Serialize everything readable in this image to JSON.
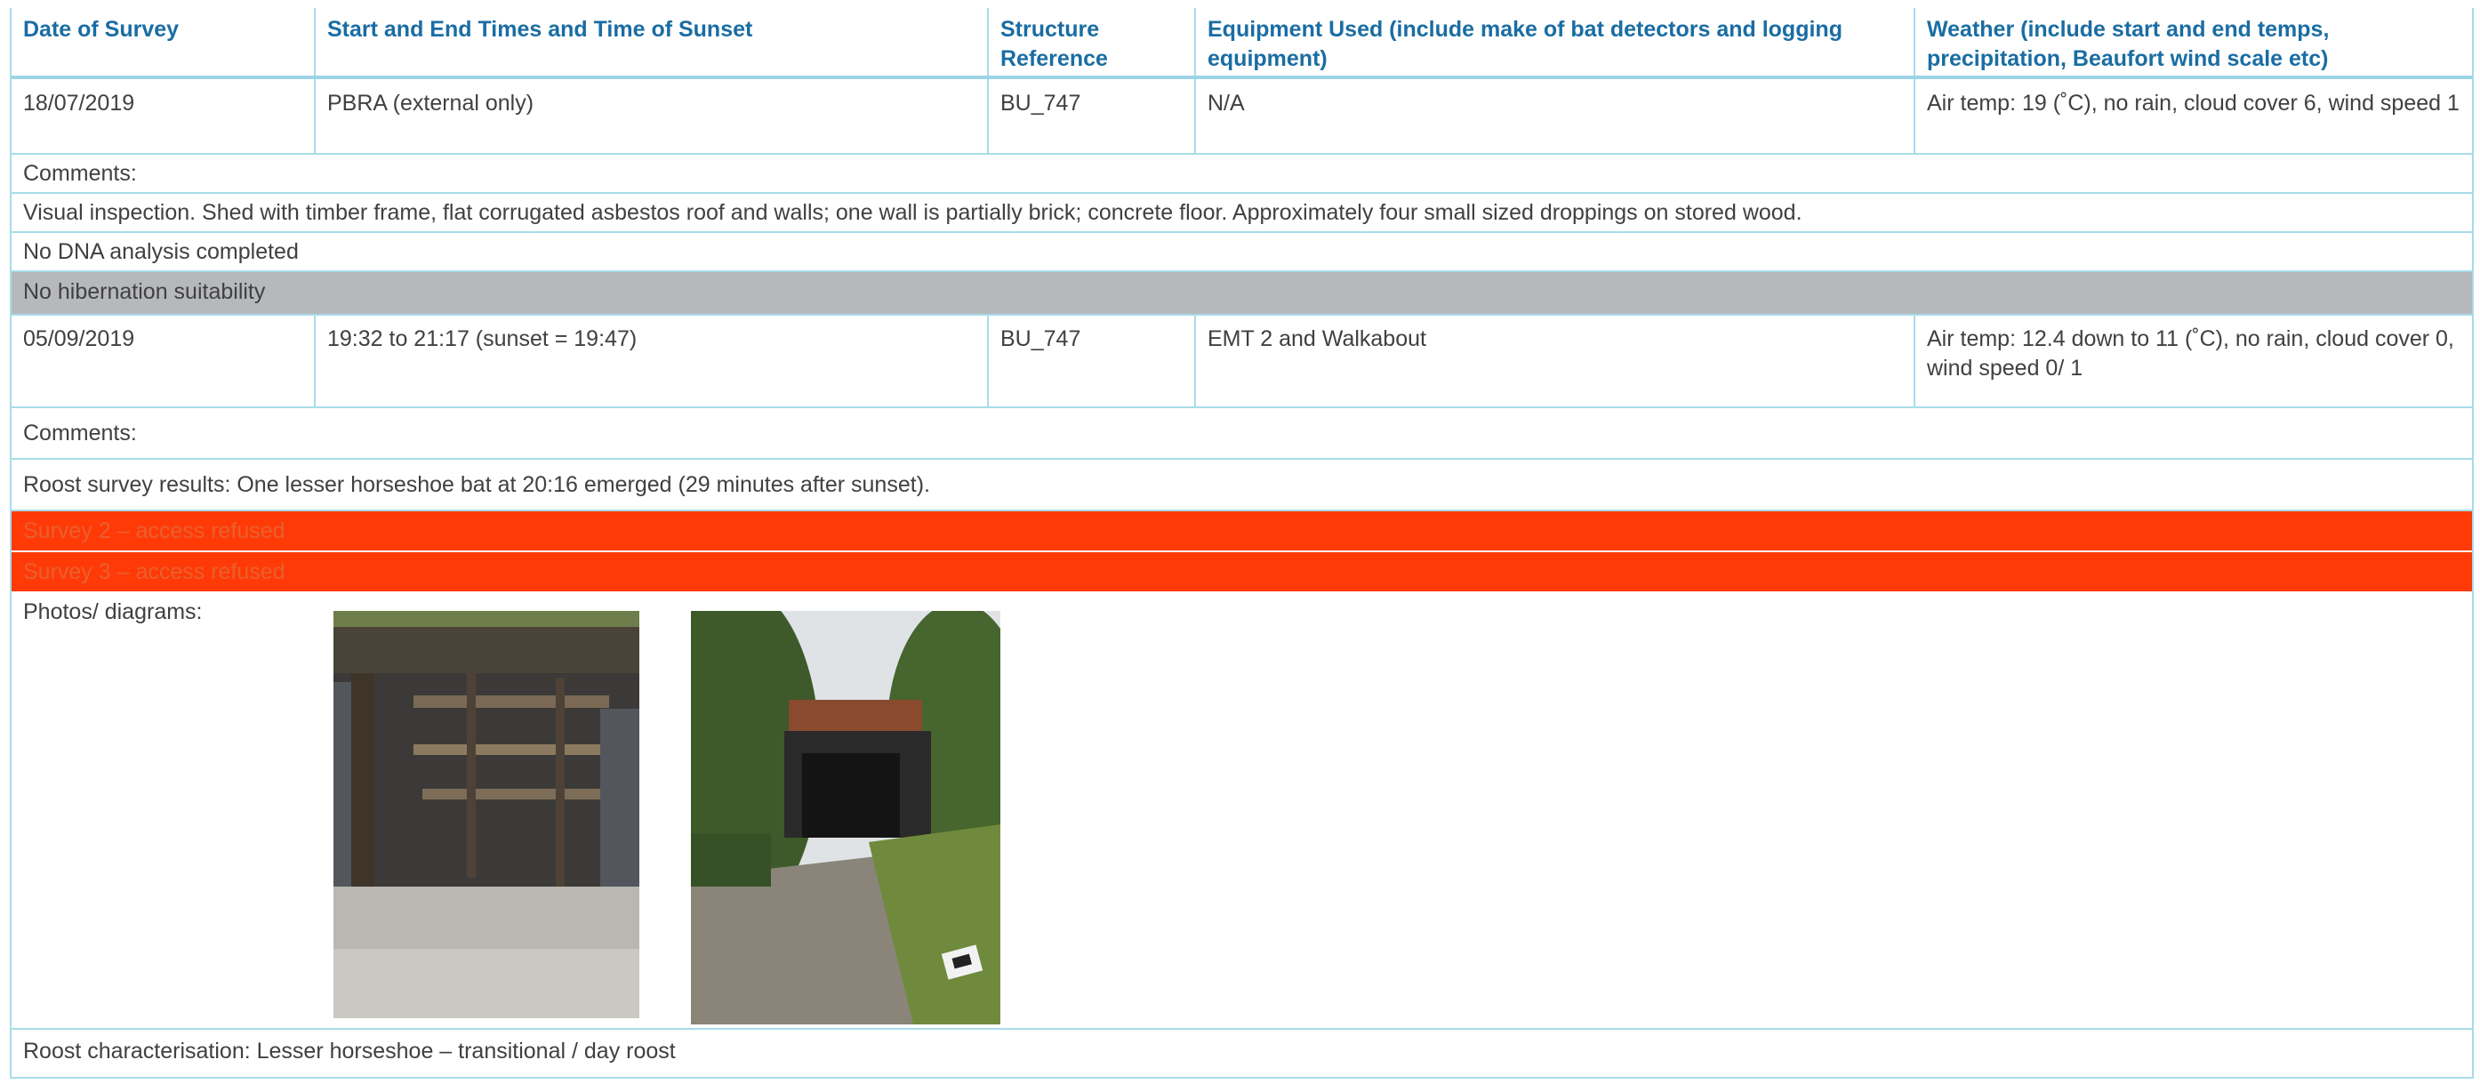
{
  "header": {
    "date": "Date of Survey",
    "times": "Start and End Times and Time of Sunset",
    "structure": "Structure Reference",
    "equipment": "Equipment Used (include make of bat detectors and logging equipment)",
    "weather": "Weather (include start and end temps, precipitation, Beaufort wind scale etc)"
  },
  "survey1": {
    "date": "18/07/2019",
    "times": "PBRA (external only)",
    "structure": "BU_747",
    "equipment": "N/A",
    "weather": "Air temp: 19 (˚C), no rain, cloud cover 6, wind speed 1",
    "comments_label": "Comments:",
    "comments": "Visual inspection. Shed with timber frame, flat corrugated asbestos roof and walls; one wall is partially brick; concrete floor. Approximately four small sized droppings on stored wood.",
    "dna": "No DNA analysis completed",
    "hibernation": "No hibernation suitability"
  },
  "survey2": {
    "date": "05/09/2019",
    "times": "19:32 to 21:17 (sunset = 19:47)",
    "structure": "BU_747",
    "equipment": "EMT 2 and Walkabout",
    "weather": "Air temp: 12.4 down to 11 (˚C), no rain, cloud cover 0, wind speed 0/ 1",
    "comments_label": "Comments:",
    "results": "Roost survey results: One lesser horseshoe bat at 20:16 emerged (29 minutes after sunset)."
  },
  "refused": [
    "Survey 2 – access refused",
    "Survey 3 – access refused"
  ],
  "photos_label": "Photos/ diagrams:",
  "characterisation": "Roost characterisation: Lesser horseshoe – transitional / day roost",
  "colors": {
    "header_text": "#1a6da3",
    "border": "#a8dcea",
    "grey_band": "#b6b8bb",
    "red_band": "#ff3a06"
  }
}
